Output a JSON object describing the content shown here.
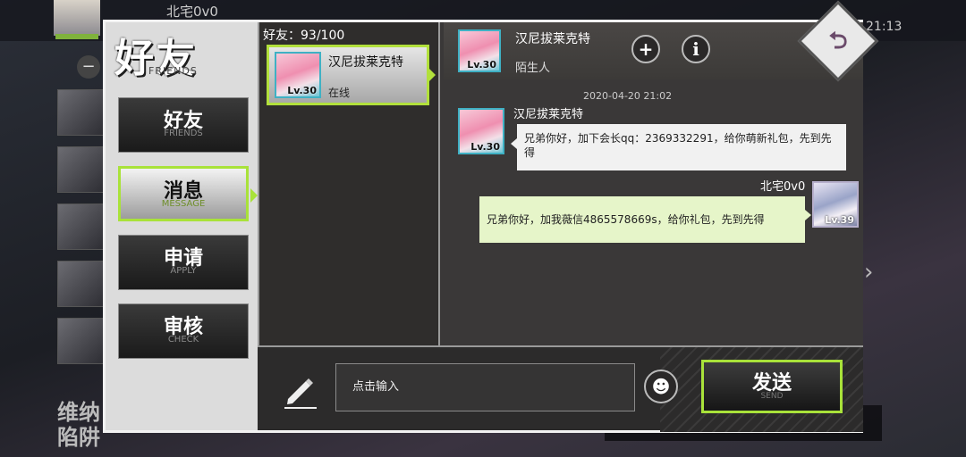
{
  "background": {
    "player_name": "北宅0v0",
    "clock": "21:13",
    "bottom_text_line1": "维纳",
    "bottom_text_line2": "陷阱"
  },
  "dialog": {
    "title": "好友",
    "title_en": "FRIENDS",
    "back_icon": "return-arrow-icon"
  },
  "sidebar": {
    "tabs": [
      {
        "label": "好友",
        "sublabel": "FRIENDS",
        "active": false
      },
      {
        "label": "消息",
        "sublabel": "MESSAGE",
        "active": true
      },
      {
        "label": "申请",
        "sublabel": "APPLY",
        "active": false
      },
      {
        "label": "审核",
        "sublabel": "CHECK",
        "active": false
      }
    ]
  },
  "friends": {
    "count_label": "好友：93/100",
    "list": [
      {
        "name": "汉尼拔莱克特",
        "level": "Lv.30",
        "status": "在线",
        "selected": true
      }
    ]
  },
  "chat": {
    "header": {
      "name": "汉尼拔莱克特",
      "level": "Lv.30",
      "relation": "陌生人",
      "add_icon": "plus-icon",
      "info_icon": "info-icon"
    },
    "timestamp": "2020-04-20 21:02",
    "messages": [
      {
        "side": "in",
        "sender": "汉尼拔莱克特",
        "level": "Lv.30",
        "text": "兄弟你好，加下会长qq：2369332291，给你萌新礼包，先到先得"
      },
      {
        "side": "out",
        "sender": "北宅0v0",
        "level": "Lv.39",
        "text": "兄弟你好，加我薇信4865578669s，给你礼包，先到先得"
      }
    ]
  },
  "composer": {
    "placeholder": "点击输入",
    "send_label": "发送",
    "send_sublabel": "SEND",
    "emoji_icon": "smiley-icon",
    "edit_icon": "pencil-icon"
  },
  "colors": {
    "accent_green": "#a9e23a",
    "dialog_border": "#f2f2f2",
    "bubble_in": "#f1f1f1",
    "bubble_out": "#e6f5c9"
  }
}
